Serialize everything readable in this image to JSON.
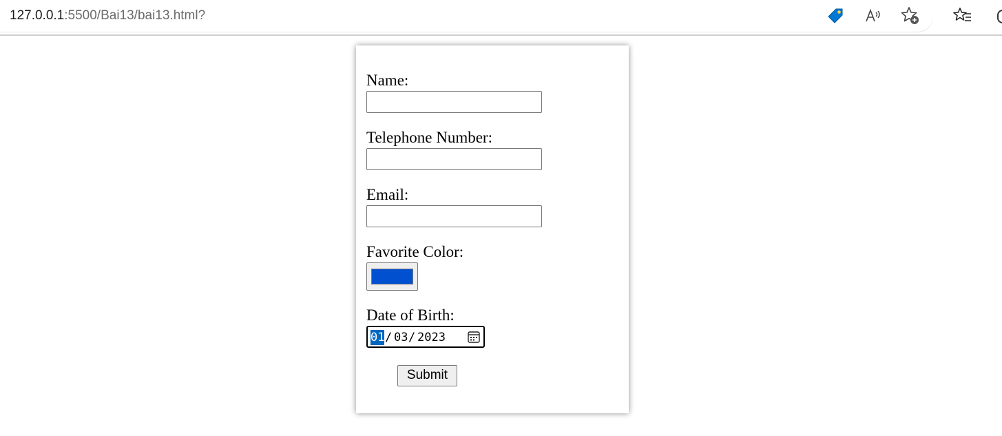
{
  "browser": {
    "url_host": "127.0.0.1",
    "url_rest": ":5500/Bai13/bai13.html?",
    "icons": [
      "tag-icon",
      "read-aloud-icon",
      "add-favorite-icon",
      "favorites-icon"
    ]
  },
  "form": {
    "name_label": "Name:",
    "name_value": "",
    "phone_label": "Telephone Number:",
    "phone_value": "",
    "email_label": "Email:",
    "email_value": "",
    "color_label": "Favorite Color:",
    "color_value": "#0050d0",
    "dob_label": "Date of Birth:",
    "dob_day": "01",
    "dob_sep": "/",
    "dob_month": "03",
    "dob_year": "2023",
    "submit_label": "Submit"
  },
  "colors": {
    "date_selection": "#0067c0",
    "tag_icon": "#0078d4"
  }
}
